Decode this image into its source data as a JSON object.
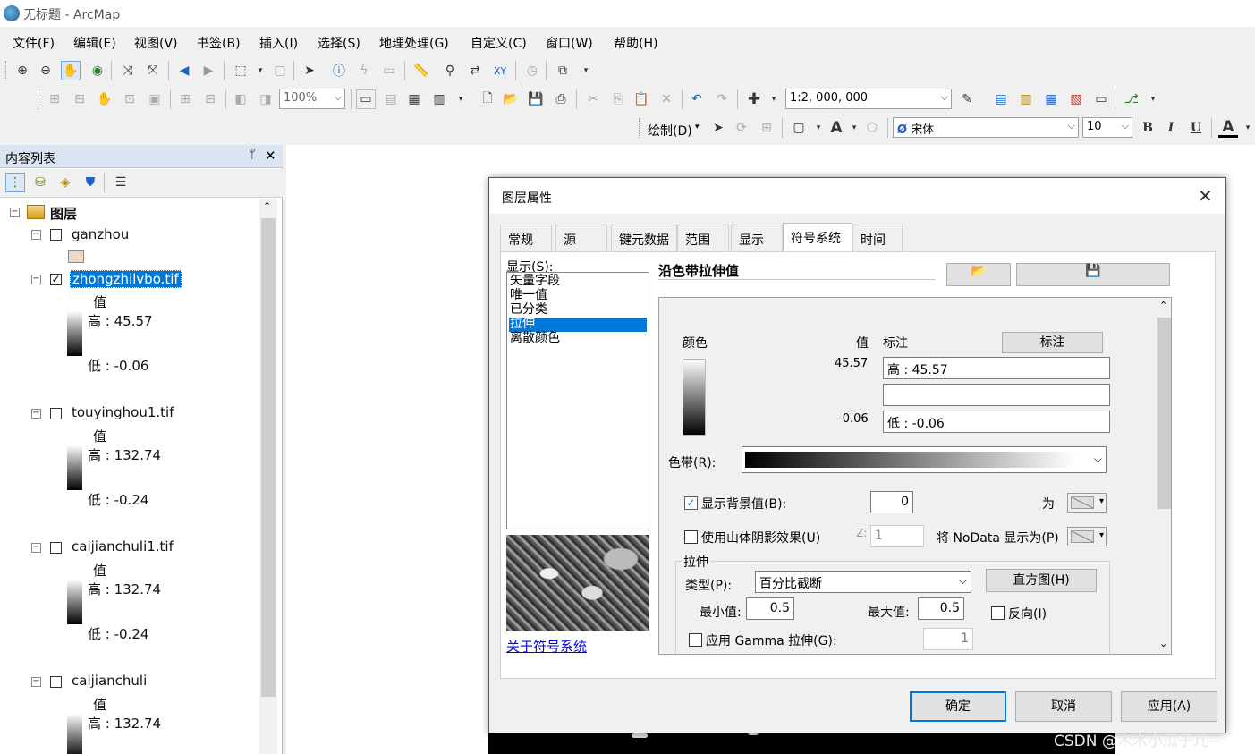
{
  "window": {
    "title": "无标题 - ArcMap"
  },
  "menu": [
    "文件(F)",
    "编辑(E)",
    "视图(V)",
    "书签(B)",
    "插入(I)",
    "选择(S)",
    "地理处理(G)",
    "自定义(C)",
    "窗口(W)",
    "帮助(H)"
  ],
  "toolbar": {
    "zoom_percent": "100%",
    "scale": "1:2, 000, 000",
    "draw_label": "绘制(D)",
    "font_name": "宋体",
    "font_size": "10",
    "bold": "B",
    "italic": "I",
    "underline": "U",
    "font_color": "A"
  },
  "toc": {
    "title": "内容列表",
    "pin": "ᛘ",
    "close": "✕",
    "root_label": "图层",
    "layers": [
      {
        "name": "ganzhou",
        "checked": false
      },
      {
        "name": "zhongzhilvbo.tif",
        "checked": true,
        "value_header": "值",
        "high": "高 : 45.57",
        "low": "低 : -0.06"
      },
      {
        "name": "touyinghou1.tif",
        "checked": false,
        "value_header": "值",
        "high": "高 : 132.74",
        "low": "低 : -0.24"
      },
      {
        "name": "caijianchuli1.tif",
        "checked": false,
        "value_header": "值",
        "high": "高 : 132.74",
        "low": "低 : -0.24"
      },
      {
        "name": "caijianchuli",
        "checked": false,
        "value_header": "值",
        "high": "高 : 132.74"
      }
    ]
  },
  "dialog": {
    "title": "图层属性",
    "close": "✕",
    "tabs": [
      "常规",
      "源",
      "键元数据",
      "范围",
      "显示",
      "符号系统",
      "时间"
    ],
    "active_tab": "符号系统",
    "show_label": "显示(S):",
    "show_items": [
      "矢量字段",
      "唯一值",
      "已分类",
      "拉伸",
      "离散颜色"
    ],
    "selected_show_item": "拉伸",
    "about_link": "关于符号系统",
    "method_title": "沿色带拉伸值",
    "color_header": "颜色",
    "value_header": "值",
    "label_header": "标注",
    "label_button": "标注",
    "high_value": "45.57",
    "low_value": "-0.06",
    "high_label": "高 : 45.57",
    "mid_label": "",
    "low_label": "低 : -0.06",
    "color_ramp_label": "色带(R):",
    "show_background_label": "显示背景值(B):",
    "show_background_checked": true,
    "background_value": "0",
    "as_label": "为",
    "hillshade_label": "使用山体阴影效果(U)",
    "z_label": "Z:",
    "z_value": "1",
    "nodata_label": "将 NoData 显示为(P)",
    "stretch_group_label": "拉伸",
    "type_label": "类型(P):",
    "type_value": "百分比截断",
    "histogram_button": "直方图(H)",
    "min_label": "最小值:",
    "min_value": "0.5",
    "max_label": "最大值:",
    "max_value": "0.5",
    "invert_label": "反向(I)",
    "gamma_label": "应用 Gamma 拉伸(G):",
    "gamma_value": "1",
    "ok_button": "确定",
    "cancel_button": "取消",
    "apply_button": "应用(A)"
  },
  "watermark": "CSDN @木木小瓜子儿~"
}
